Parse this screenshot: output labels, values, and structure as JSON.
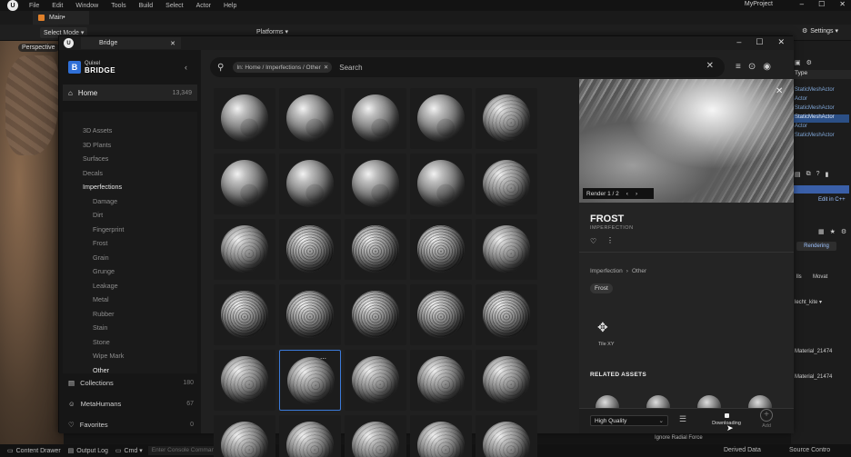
{
  "editor": {
    "menu": [
      "File",
      "Edit",
      "Window",
      "Tools",
      "Build",
      "Select",
      "Actor",
      "Help"
    ],
    "project_name": "MyProject",
    "main_tab": "Main•",
    "select_mode": "Select Mode ▾",
    "platforms": "Platforms ▾",
    "settings": "Settings ▾",
    "viewport_label": "Perspective",
    "bottom": {
      "content_drawer": "Content Drawer",
      "output_log": "Output Log",
      "cmd": "Cmd ▾",
      "console_placeholder": "Enter Console Command",
      "derived_data": "Derived Data",
      "source_control": "Source Contro"
    },
    "ignore_radial": "Ignore Radial Force",
    "right_panel": {
      "header": "Type",
      "rows": [
        "StaticMeshActor",
        "Actor",
        "StaticMeshActor",
        "StaticMeshActor",
        "Actor",
        "StaticMeshActor"
      ],
      "edit_cpp": "Edit in C++",
      "rendering": "Rendering",
      "tags": [
        "lls",
        "Movat"
      ],
      "dropdown": "lecht_kite ▾",
      "materials": [
        "Material_21474",
        "Material_21474"
      ]
    }
  },
  "bridge": {
    "window_title": "Bridge",
    "logo_top": "Quixel",
    "logo_bottom": "BRIDGE",
    "home": {
      "label": "Home",
      "count": "13,349"
    },
    "categories": [
      {
        "label": "3D Assets",
        "level": 1
      },
      {
        "label": "3D Plants",
        "level": 1
      },
      {
        "label": "Surfaces",
        "level": 1
      },
      {
        "label": "Decals",
        "level": 1
      },
      {
        "label": "Imperfections",
        "level": 1,
        "active": true
      },
      {
        "label": "Damage",
        "level": 2
      },
      {
        "label": "Dirt",
        "level": 2
      },
      {
        "label": "Fingerprint",
        "level": 2
      },
      {
        "label": "Frost",
        "level": 2
      },
      {
        "label": "Grain",
        "level": 2
      },
      {
        "label": "Grunge",
        "level": 2
      },
      {
        "label": "Leakage",
        "level": 2
      },
      {
        "label": "Metal",
        "level": 2
      },
      {
        "label": "Rubber",
        "level": 2
      },
      {
        "label": "Stain",
        "level": 2
      },
      {
        "label": "Stone",
        "level": 2
      },
      {
        "label": "Wipe Mark",
        "level": 2
      },
      {
        "label": "Other",
        "level": 2,
        "active": true
      }
    ],
    "bottom_nav": [
      {
        "label": "Collections",
        "count": "180",
        "icon": "collections-icon"
      },
      {
        "label": "MetaHumans",
        "count": "67",
        "icon": "metahumans-icon"
      },
      {
        "label": "Favorites",
        "count": "0",
        "icon": "favorites-icon"
      }
    ],
    "search": {
      "filter_chip": "In: Home / Imperfections / Other",
      "placeholder": "Search"
    },
    "detail": {
      "render_label": "Render 1 / 2",
      "title": "FROST",
      "subtitle": "IMPERFECTION",
      "breadcrumb": [
        "Imperfection",
        "›",
        "Other"
      ],
      "tag": "Frost",
      "tile_label": "Tile XY",
      "related_heading": "RELATED ASSETS",
      "quality": "High Quality",
      "download_label": "Downloading",
      "add_label": "Add"
    },
    "grid": {
      "rows": 6,
      "cols": 5,
      "selected_index": 21,
      "heavy": [
        11,
        12,
        13,
        15,
        16,
        17,
        18,
        19
      ],
      "light": [
        0,
        1,
        2,
        3,
        5,
        6,
        7,
        8
      ]
    },
    "colors": {
      "accent": "#3b7ad9",
      "logo": "#2f6fd6"
    }
  }
}
